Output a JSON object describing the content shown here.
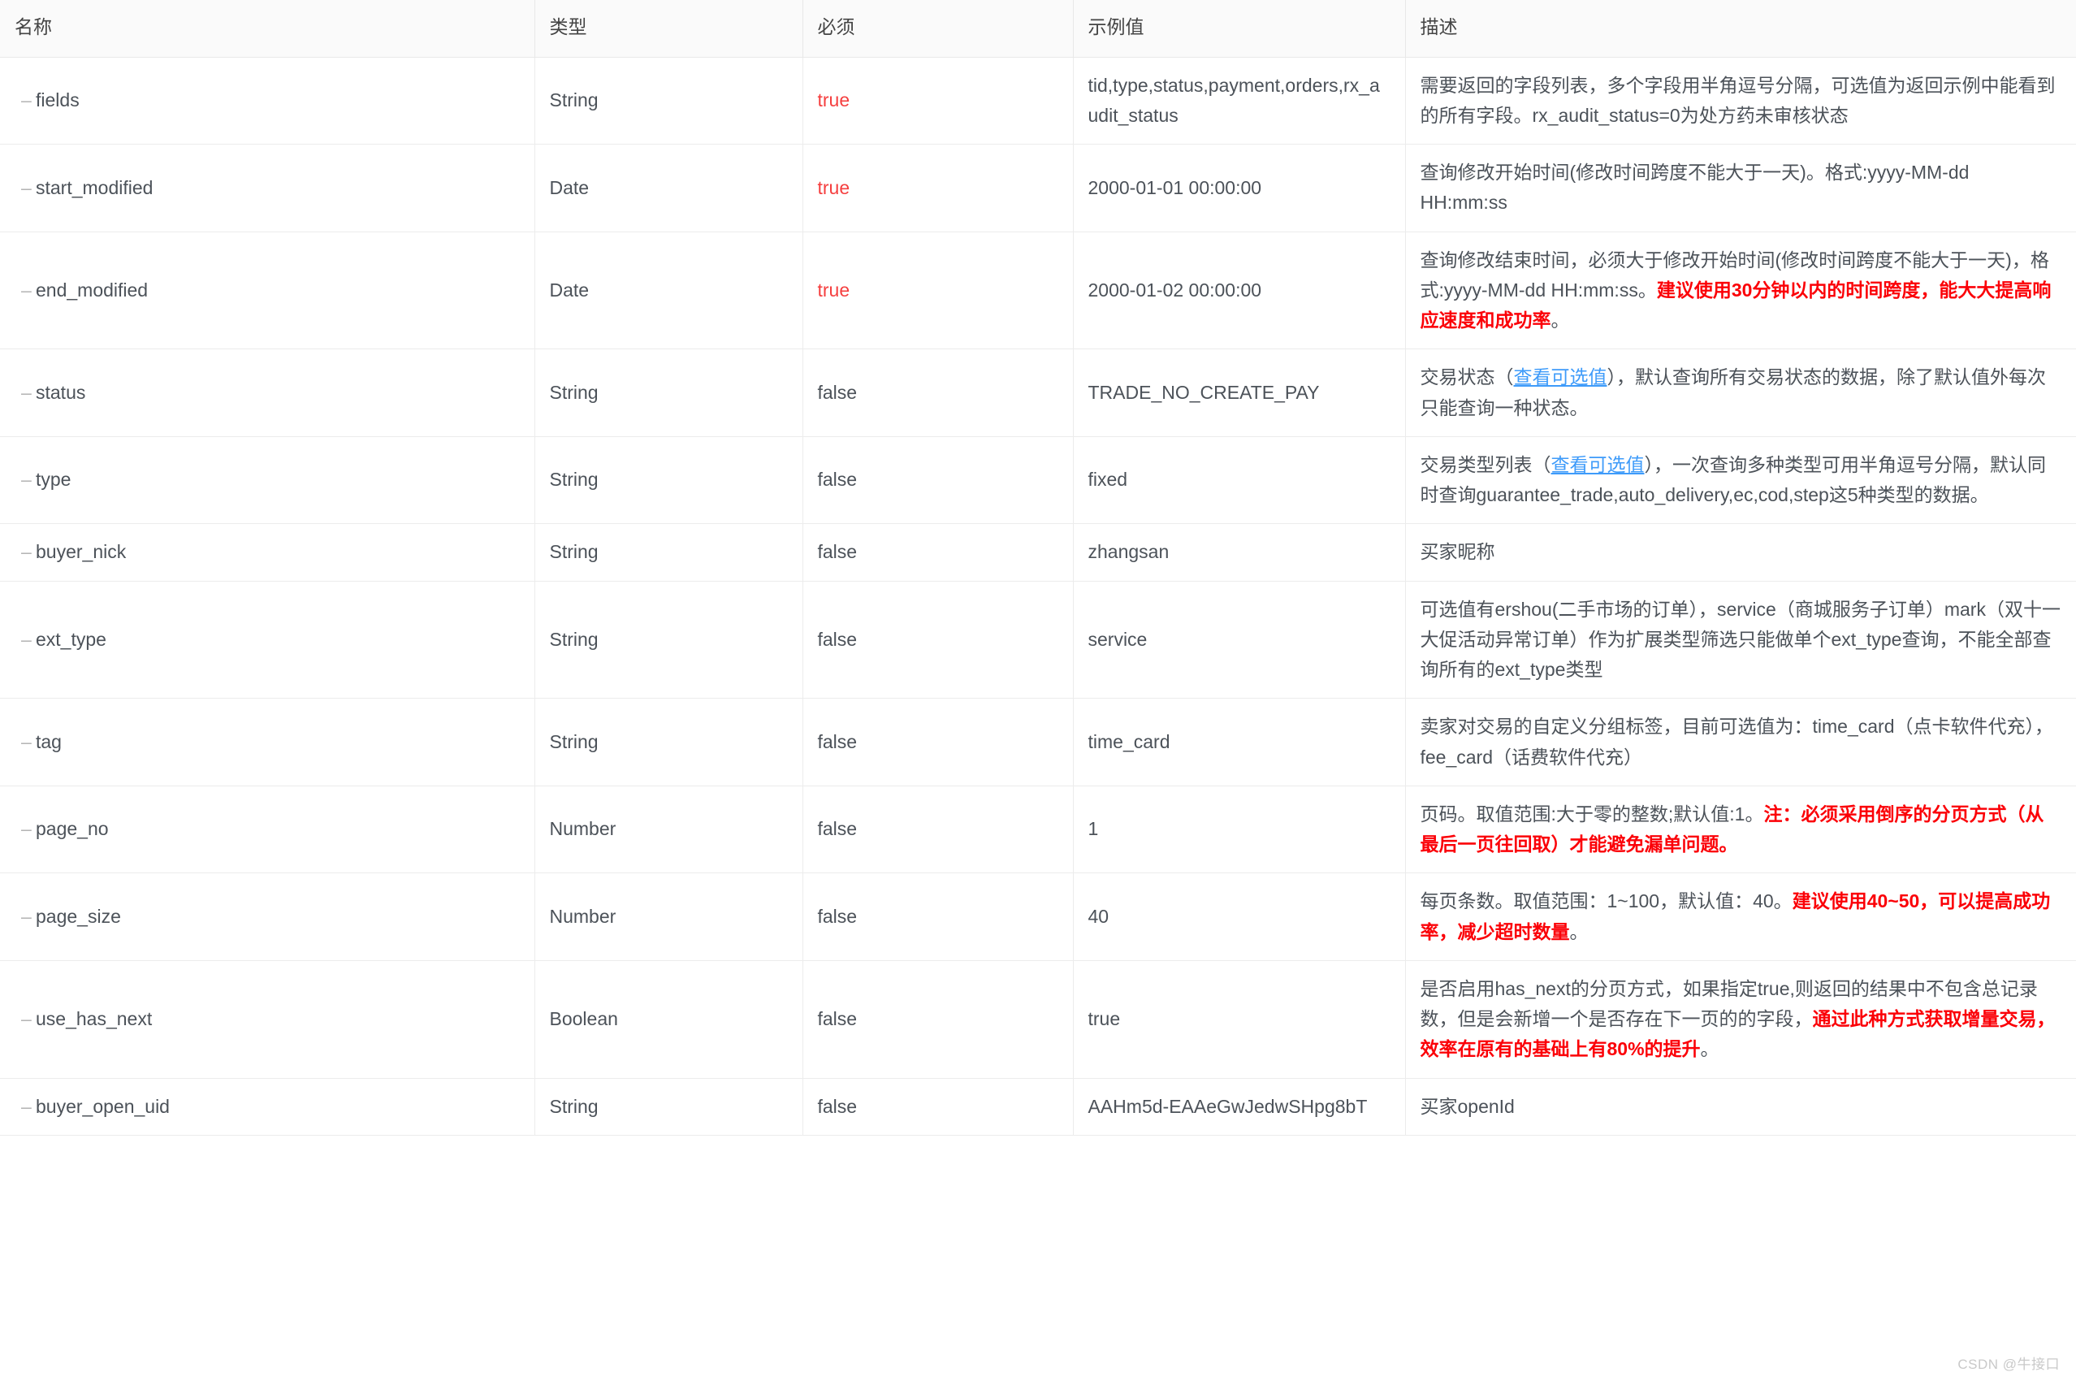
{
  "table": {
    "headers": [
      "名称",
      "类型",
      "必须",
      "示例值",
      "描述"
    ],
    "rows": [
      {
        "name": "fields",
        "type": "String",
        "required": "true",
        "required_emphasis": true,
        "example": "tid,type,status,payment,orders,rx_audit_status",
        "desc_parts": [
          {
            "t": "需要返回的字段列表，多个字段用半角逗号分隔，可选值为返回示例中能看到的所有字段。rx_audit_status=0为处方药未审核状态",
            "s": "plain"
          }
        ]
      },
      {
        "name": "start_modified",
        "type": "Date",
        "required": "true",
        "required_emphasis": true,
        "example": "2000-01-01 00:00:00",
        "desc_parts": [
          {
            "t": "查询修改开始时间(修改时间跨度不能大于一天)。格式:yyyy-MM-dd HH:mm:ss",
            "s": "plain"
          }
        ]
      },
      {
        "name": "end_modified",
        "type": "Date",
        "required": "true",
        "required_emphasis": true,
        "example": "2000-01-02 00:00:00",
        "desc_parts": [
          {
            "t": "查询修改结束时间，必须大于修改开始时间(修改时间跨度不能大于一天)，格式:yyyy-MM-dd HH:mm:ss。",
            "s": "plain"
          },
          {
            "t": "建议使用30分钟以内的时间跨度，能大大提高响应速度和成功率",
            "s": "highlight"
          },
          {
            "t": "。",
            "s": "plain"
          }
        ]
      },
      {
        "name": "status",
        "type": "String",
        "required": "false",
        "required_emphasis": false,
        "example": "TRADE_NO_CREATE_PAY",
        "desc_parts": [
          {
            "t": "交易状态（",
            "s": "plain"
          },
          {
            "t": "查看可选值",
            "s": "link"
          },
          {
            "t": "），默认查询所有交易状态的数据，除了默认值外每次只能查询一种状态。",
            "s": "plain"
          }
        ]
      },
      {
        "name": "type",
        "type": "String",
        "required": "false",
        "required_emphasis": false,
        "example": "fixed",
        "desc_parts": [
          {
            "t": "交易类型列表（",
            "s": "plain"
          },
          {
            "t": "查看可选值",
            "s": "link"
          },
          {
            "t": "），一次查询多种类型可用半角逗号分隔，默认同时查询guarantee_trade,auto_delivery,ec,cod,step这5种类型的数据。",
            "s": "plain"
          }
        ]
      },
      {
        "name": "buyer_nick",
        "type": "String",
        "required": "false",
        "required_emphasis": false,
        "example": "zhangsan",
        "desc_parts": [
          {
            "t": "买家昵称",
            "s": "plain"
          }
        ]
      },
      {
        "name": "ext_type",
        "type": "String",
        "required": "false",
        "required_emphasis": false,
        "example": "service",
        "desc_parts": [
          {
            "t": "可选值有ershou(二手市场的订单），service（商城服务子订单）mark（双十一大促活动异常订单）作为扩展类型筛选只能做单个ext_type查询，不能全部查询所有的ext_type类型",
            "s": "plain"
          }
        ]
      },
      {
        "name": "tag",
        "type": "String",
        "required": "false",
        "required_emphasis": false,
        "example": "time_card",
        "desc_parts": [
          {
            "t": "卖家对交易的自定义分组标签，目前可选值为：time_card（点卡软件代充），fee_card（话费软件代充）",
            "s": "plain"
          }
        ]
      },
      {
        "name": "page_no",
        "type": "Number",
        "required": "false",
        "required_emphasis": false,
        "example": "1",
        "desc_parts": [
          {
            "t": "页码。取值范围:大于零的整数;默认值:1。",
            "s": "plain"
          },
          {
            "t": "注：必须采用倒序的分页方式（从最后一页往回取）才能避免漏单问题。",
            "s": "highlight"
          }
        ]
      },
      {
        "name": "page_size",
        "type": "Number",
        "required": "false",
        "required_emphasis": false,
        "example": "40",
        "desc_parts": [
          {
            "t": "每页条数。取值范围：1~100，默认值：40。",
            "s": "plain"
          },
          {
            "t": "建议使用40~50，可以提高成功率，减少超时数量",
            "s": "highlight"
          },
          {
            "t": "。",
            "s": "plain"
          }
        ]
      },
      {
        "name": "use_has_next",
        "type": "Boolean",
        "required": "false",
        "required_emphasis": false,
        "example": "true",
        "desc_parts": [
          {
            "t": "是否启用has_next的分页方式，如果指定true,则返回的结果中不包含总记录数，但是会新增一个是否存在下一页的的字段，",
            "s": "plain"
          },
          {
            "t": "通过此种方式获取增量交易，效率在原有的基础上有80%的提升",
            "s": "highlight"
          },
          {
            "t": "。",
            "s": "plain"
          }
        ]
      },
      {
        "name": "buyer_open_uid",
        "type": "String",
        "required": "false",
        "required_emphasis": false,
        "example": "AAHm5d-EAAeGwJedwSHpg8bT",
        "desc_parts": [
          {
            "t": "买家openId",
            "s": "plain"
          }
        ]
      }
    ]
  },
  "watermark": "CSDN @牛接口",
  "colors": {
    "required_true": "#f53f3f",
    "highlight": "#fb0007",
    "link": "#3e9bfa",
    "header_bg": "#fafafa",
    "border": "#ececec",
    "text": "#4c5259"
  }
}
